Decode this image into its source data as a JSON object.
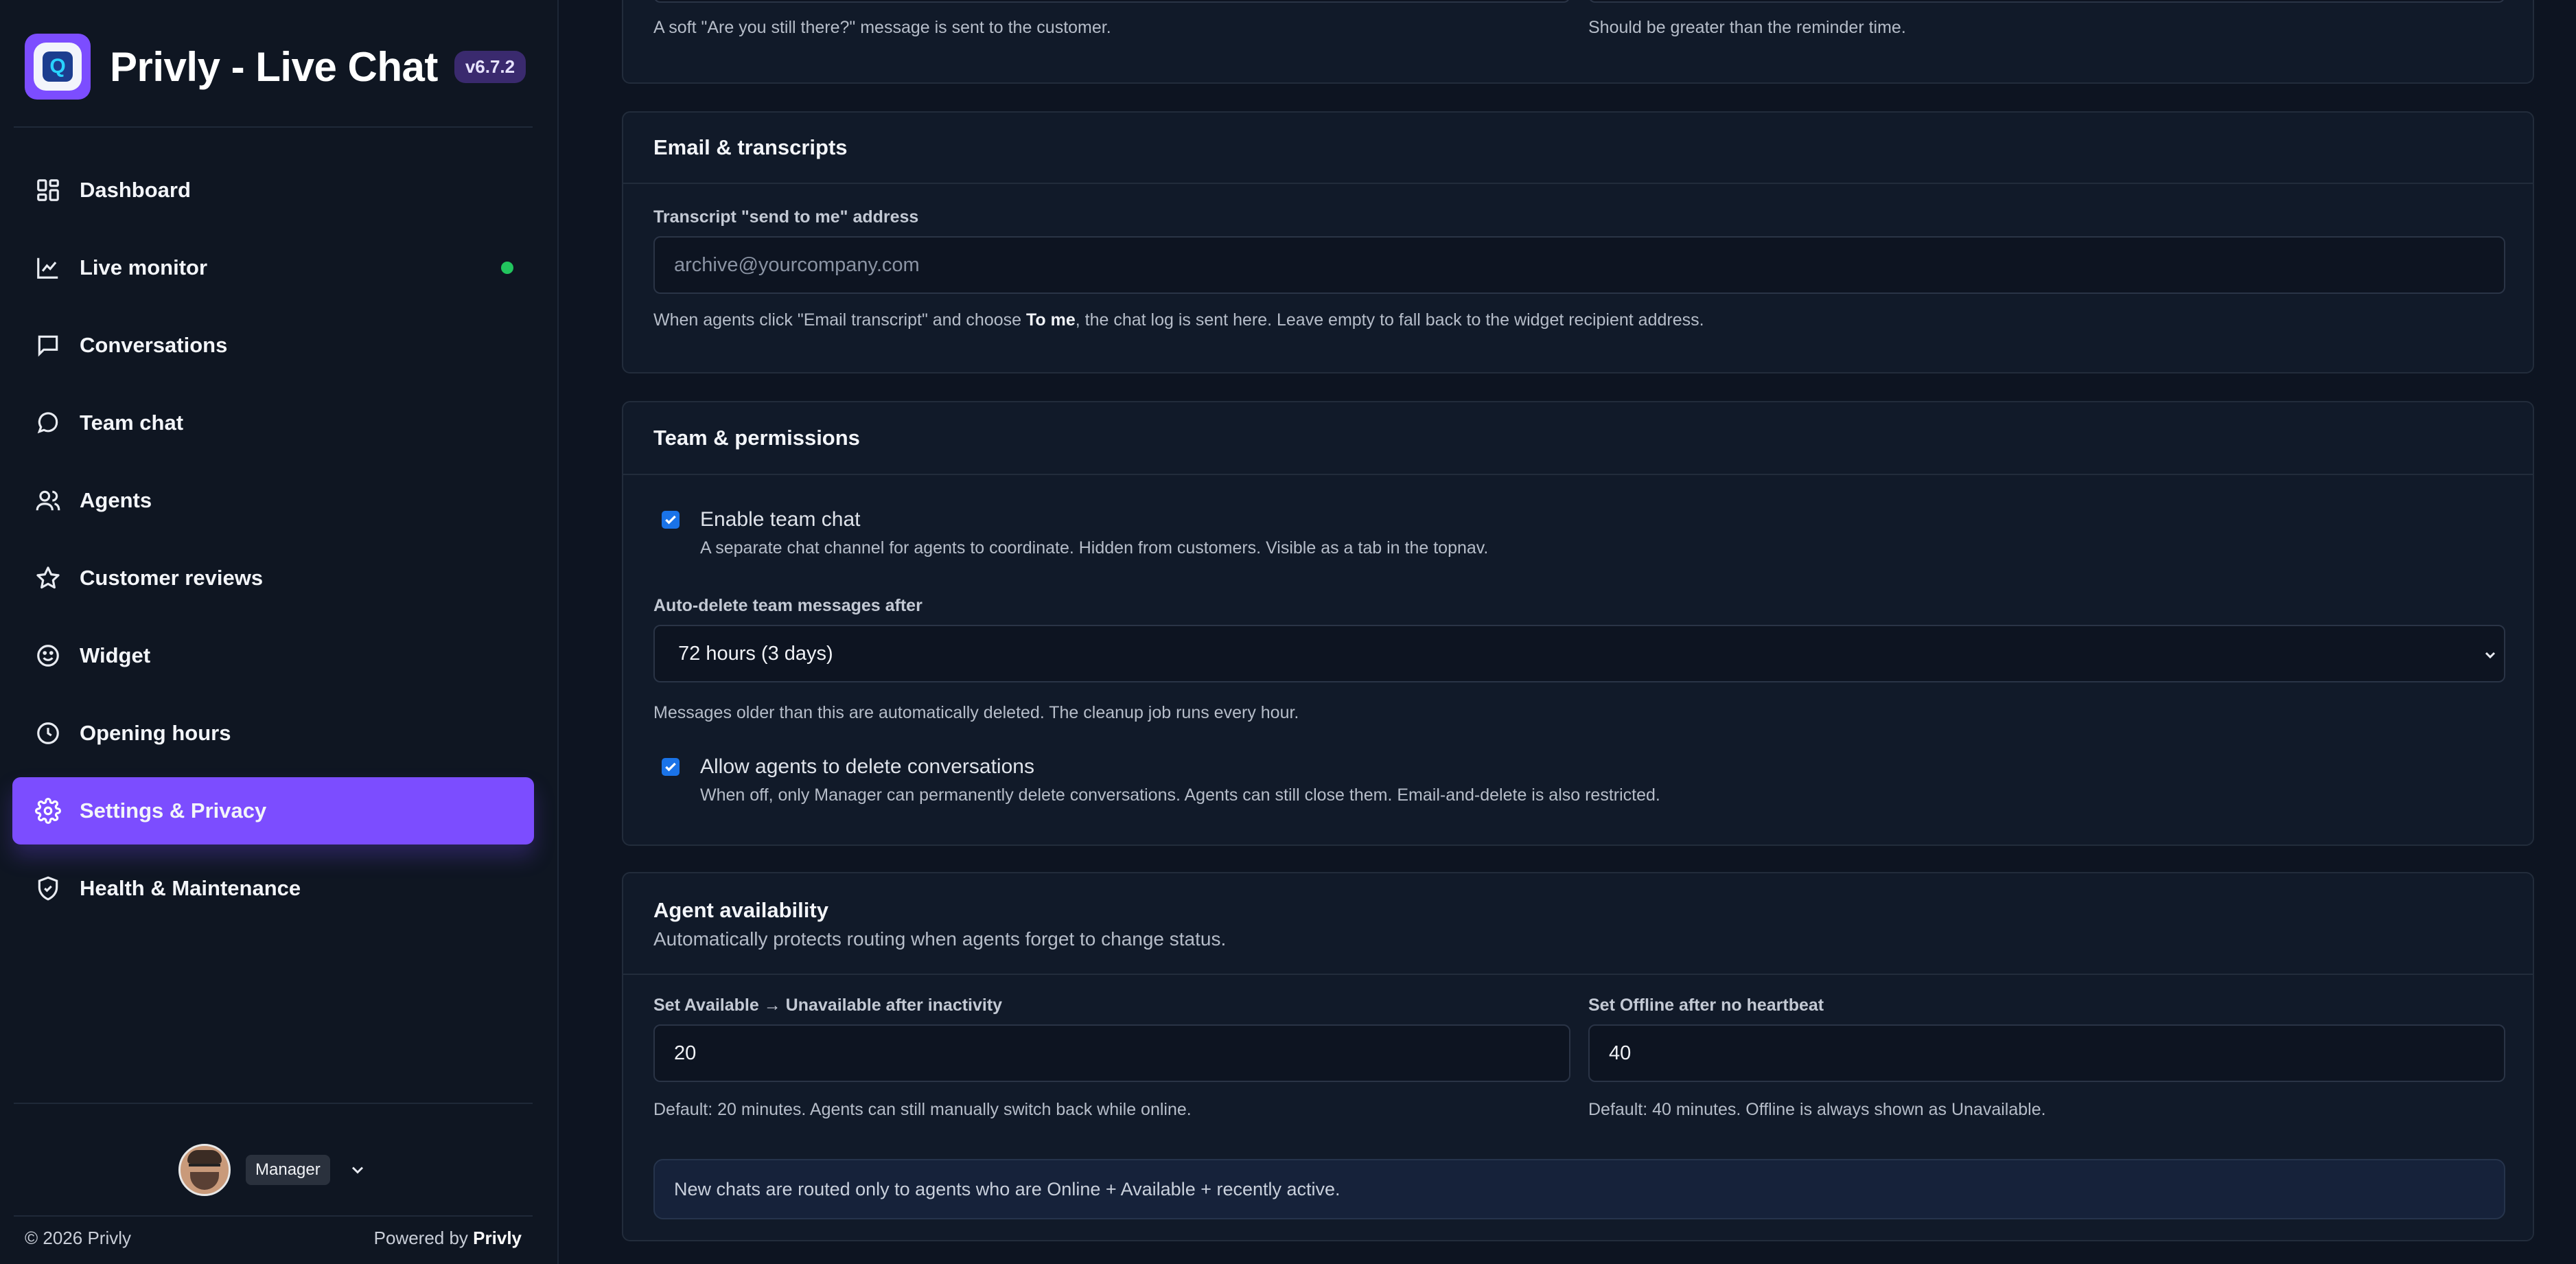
{
  "app": {
    "title": "Privly - Live Chat",
    "version": "v6.7.2"
  },
  "nav": [
    {
      "label": "Dashboard",
      "icon": "dashboard-icon"
    },
    {
      "label": "Live monitor",
      "icon": "chart-line-icon"
    },
    {
      "label": "Conversations",
      "icon": "message-square-icon"
    },
    {
      "label": "Team chat",
      "icon": "message-circle-icon"
    },
    {
      "label": "Agents",
      "icon": "users-icon"
    },
    {
      "label": "Customer reviews",
      "icon": "star-icon"
    },
    {
      "label": "Widget",
      "icon": "smiley-icon"
    },
    {
      "label": "Opening hours",
      "icon": "clock-icon"
    },
    {
      "label": "Settings & Privacy",
      "icon": "gear-icon",
      "active": true
    },
    {
      "label": "Health & Maintenance",
      "icon": "shield-icon"
    }
  ],
  "user": {
    "role": "Manager"
  },
  "footer": {
    "copyright": "© 2026 Privly",
    "powered_prefix": "Powered by",
    "powered_brand": "Privly"
  },
  "colors": {
    "accent": "#7c4dff",
    "live": "#22c55e",
    "checkbox": "#1a73e8"
  },
  "top_partial": {
    "help_left": "A soft \"Are you still there?\" message is sent to the customer.",
    "help_right": "Should be greater than the reminder time."
  },
  "email": {
    "title": "Email & transcripts",
    "field_label": "Transcript \"send to me\" address",
    "placeholder": "archive@yourcompany.com",
    "help_before": "When agents click \"Email transcript\" and choose ",
    "help_bold": "To me",
    "help_after": ", the chat log is sent here. Leave empty to fall back to the widget recipient address."
  },
  "team": {
    "title": "Team & permissions",
    "enable_chat_label": "Enable team chat",
    "enable_chat_help": "A separate chat channel for agents to coordinate. Hidden from customers. Visible as a tab in the topnav.",
    "enable_chat_checked": true,
    "autodelete_label": "Auto-delete team messages after",
    "autodelete_value": "72 hours (3 days)",
    "autodelete_help": "Messages older than this are automatically deleted. The cleanup job runs every hour.",
    "allow_delete_label": "Allow agents to delete conversations",
    "allow_delete_help": "When off, only Manager can permanently delete conversations. Agents can still close them. Email-and-delete is also restricted.",
    "allow_delete_checked": true
  },
  "availability": {
    "title": "Agent availability",
    "subtitle": "Automatically protects routing when agents forget to change status.",
    "inactivity_label": "Set Available → Unavailable after inactivity",
    "inactivity_value": "20",
    "inactivity_help": "Default: 20 minutes. Agents can still manually switch back while online.",
    "offline_label": "Set Offline after no heartbeat",
    "offline_value": "40",
    "offline_help": "Default: 40 minutes. Offline is always shown as Unavailable.",
    "info": "New chats are routed only to agents who are Online + Available + recently active."
  }
}
